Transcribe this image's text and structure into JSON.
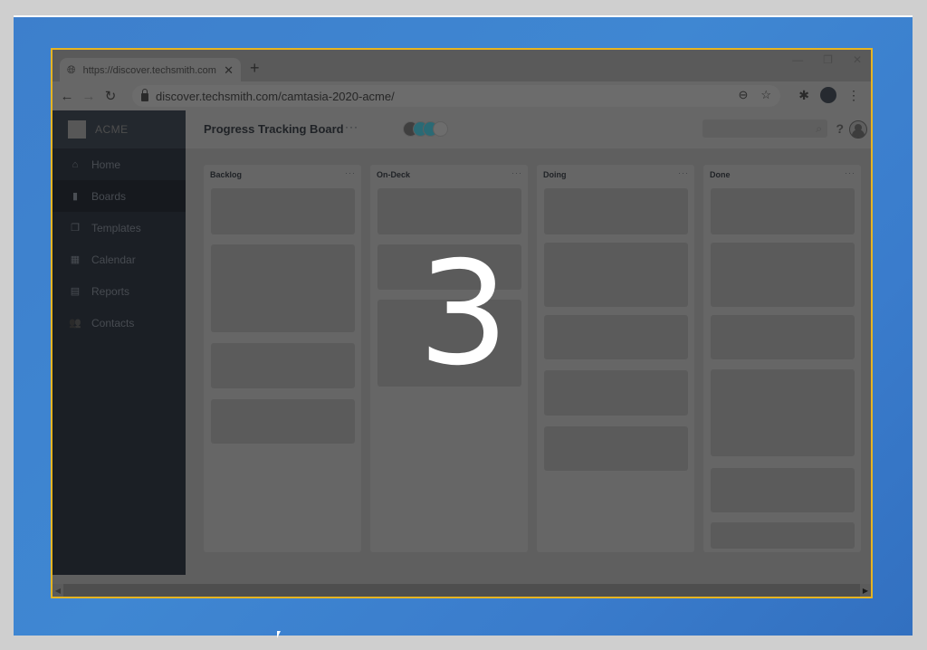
{
  "browser": {
    "tab_title": "https://discover.techsmith.com/c",
    "tab_close": "✕",
    "new_tab": "+",
    "window_controls": [
      "—",
      "❐",
      "✕"
    ],
    "nav": {
      "back": "←",
      "forward": "→",
      "reload": "↻"
    },
    "url": "discover.techsmith.com/camtasia-2020-acme/",
    "zoom_icon": "⊖",
    "star_icon": "☆",
    "extensions_icon": "✱",
    "menu_icon": "⋮"
  },
  "app": {
    "brand": "ACME",
    "sidebar": {
      "items": [
        {
          "label": "Home",
          "icon": "⌂",
          "active": false
        },
        {
          "label": "Boards",
          "icon": "▮",
          "active": true
        },
        {
          "label": "Templates",
          "icon": "❐",
          "active": false
        },
        {
          "label": "Calendar",
          "icon": "▦",
          "active": false
        },
        {
          "label": "Reports",
          "icon": "▤",
          "active": false
        },
        {
          "label": "Contacts",
          "icon": "👥",
          "active": false
        }
      ]
    },
    "header": {
      "title": "Progress Tracking Board",
      "more": "···",
      "avatar_colors": [
        "#3f3f3f",
        "#2a6a75",
        "#2a6a75",
        "#6d6d6d"
      ],
      "search_placeholder": "",
      "search_icon": "⌕",
      "help": "?"
    },
    "columns": [
      {
        "title": "Backlog",
        "more": "···",
        "card_count": 4
      },
      {
        "title": "On-Deck",
        "more": "···",
        "card_count": 3
      },
      {
        "title": "Doing",
        "more": "···",
        "card_count": 5
      },
      {
        "title": "Done",
        "more": "···",
        "card_count": 6
      }
    ]
  },
  "overlay": {
    "countdown": "3"
  },
  "scrollbar": {
    "left": "◀",
    "right": "▶"
  }
}
